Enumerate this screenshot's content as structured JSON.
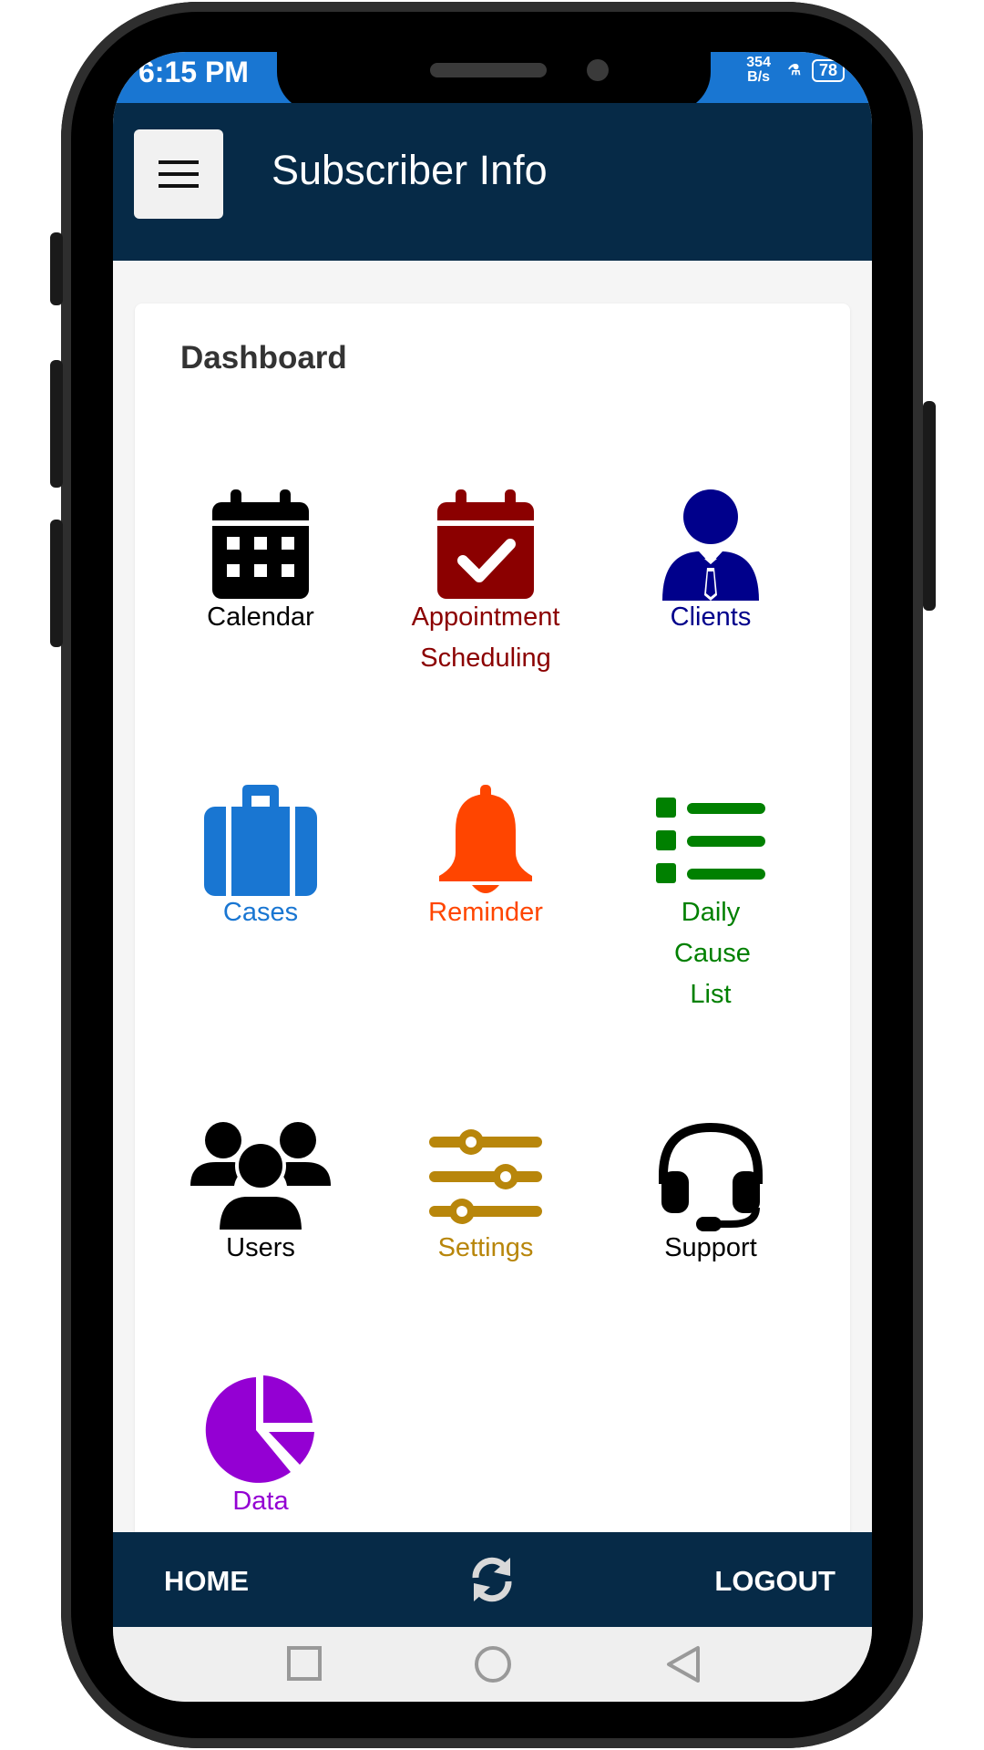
{
  "status_bar": {
    "time": "6:15 PM",
    "network_speed": "354 B/s",
    "battery": "78"
  },
  "app_bar": {
    "title": "Subscriber Info"
  },
  "dashboard": {
    "title": "Dashboard",
    "tiles": [
      {
        "label": "Calendar",
        "icon": "calendar-icon",
        "color": "#000000"
      },
      {
        "label": "Appointment Scheduling",
        "icon": "calendar-check-icon",
        "color": "#8b0000"
      },
      {
        "label": "Clients",
        "icon": "user-tie-icon",
        "color": "#00008b"
      },
      {
        "label": "Cases",
        "icon": "suitcase-icon",
        "color": "#1976d2"
      },
      {
        "label": "Reminder",
        "icon": "bell-icon",
        "color": "#ff4500"
      },
      {
        "label": "Daily Cause List",
        "icon": "list-icon",
        "color": "#008000"
      },
      {
        "label": "Users",
        "icon": "users-icon",
        "color": "#000000"
      },
      {
        "label": "Settings",
        "icon": "sliders-icon",
        "color": "#b8860b"
      },
      {
        "label": "Support",
        "icon": "headset-icon",
        "color": "#000000"
      },
      {
        "label": "Data",
        "icon": "pie-chart-icon",
        "color": "#9400d3"
      }
    ]
  },
  "bottom_bar": {
    "home_label": "HOME",
    "logout_label": "LOGOUT",
    "refresh_icon": "refresh-icon"
  },
  "theme": {
    "app_bar_color": "#062a47",
    "status_bar_color": "#1976d2"
  }
}
